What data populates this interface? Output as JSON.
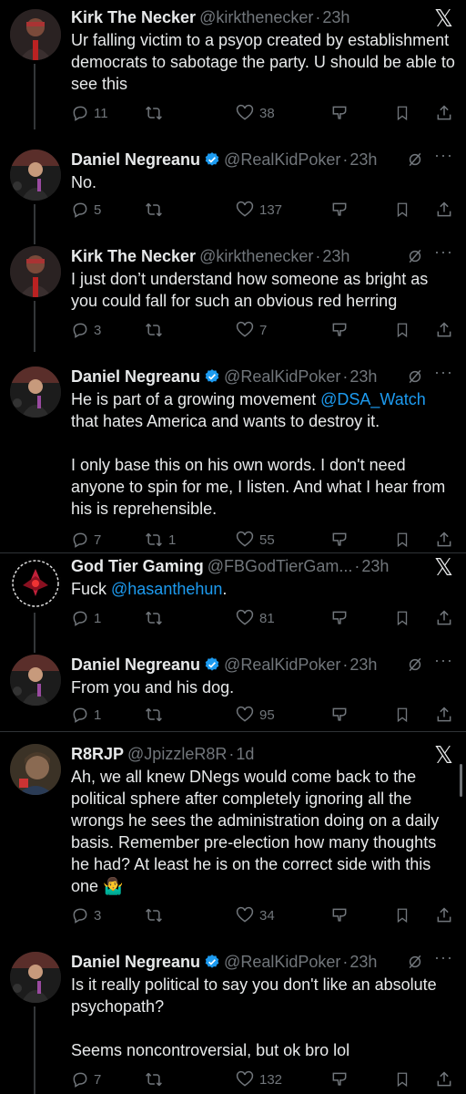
{
  "tweets": [
    {
      "name": "Kirk The Necker",
      "verified": false,
      "handle": "@kirkthenecker",
      "dot": "·",
      "time": "23h",
      "text": "Ur falling victim to a psyop created by establishment democrats to sabotage the party. U should be able to see this",
      "replies": "11",
      "retweets": "",
      "likes": "38",
      "corner": "x-logo"
    },
    {
      "name": "Daniel Negreanu",
      "verified": true,
      "handle": "@RealKidPoker",
      "dot": "·",
      "time": "23h",
      "text": "No.",
      "replies": "5",
      "retweets": "",
      "likes": "137",
      "corner": "grok-more"
    },
    {
      "name": "Kirk The Necker",
      "verified": false,
      "handle": "@kirkthenecker",
      "dot": "·",
      "time": "23h",
      "text": "I just don’t understand how someone as bright as you could fall for such an obvious red herring",
      "replies": "3",
      "retweets": "",
      "likes": "7",
      "corner": "grok-more"
    },
    {
      "name": "Daniel Negreanu",
      "verified": true,
      "handle": "@RealKidPoker",
      "dot": "·",
      "time": "23h",
      "text_pre": "He is part of a growing movement ",
      "mention": "@DSA_Watch",
      "text_post": " that hates America and wants to destroy it.\n\nI only base this on his own words. I don't need anyone to spin for me, I listen. And what I hear from his is reprehensible.",
      "replies": "7",
      "retweets": "1",
      "likes": "55",
      "corner": "grok-more"
    },
    {
      "name": "God Tier Gaming",
      "verified": false,
      "handle": "@FBGodTierGam...",
      "dot": "·",
      "time": "23h",
      "text_pre": "Fuck ",
      "mention": "@hasanthehun",
      "text_post": ".",
      "replies": "1",
      "retweets": "",
      "likes": "81",
      "corner": "x-logo"
    },
    {
      "name": "Daniel Negreanu",
      "verified": true,
      "handle": "@RealKidPoker",
      "dot": "·",
      "time": "23h",
      "text": "From you and his dog.",
      "replies": "1",
      "retweets": "",
      "likes": "95",
      "corner": "grok-more"
    },
    {
      "name": "R8RJP",
      "verified": false,
      "handle": "@JpizzleR8R",
      "dot": "·",
      "time": "1d",
      "text": "Ah, we all knew DNegs would come back to the political sphere after completely ignoring all the wrongs he sees the administration doing on a daily basis. Remember pre-election how many thoughts he had? At least he is on the correct side with this one 🤷‍♂️",
      "replies": "3",
      "retweets": "",
      "likes": "34",
      "corner": "x-logo"
    },
    {
      "name": "Daniel Negreanu",
      "verified": true,
      "handle": "@RealKidPoker",
      "dot": "·",
      "time": "23h",
      "text": "Is it really political to say you don't like an absolute psychopath?\n\nSeems noncontroversial, but ok bro lol",
      "replies": "7",
      "retweets": "",
      "likes": "132",
      "corner": "grok-more"
    }
  ],
  "icons": {
    "reply": "reply-icon",
    "retweet": "retweet-icon",
    "like": "heart-icon",
    "views": "views-icon",
    "bookmark": "bookmark-icon",
    "share": "share-icon",
    "more_label": "···",
    "x_label": "𝕏"
  },
  "colors": {
    "background": "#000000",
    "text": "#e7e9ea",
    "muted": "#71767b",
    "link": "#1d9bf0",
    "verified": "#1d9bf0"
  }
}
